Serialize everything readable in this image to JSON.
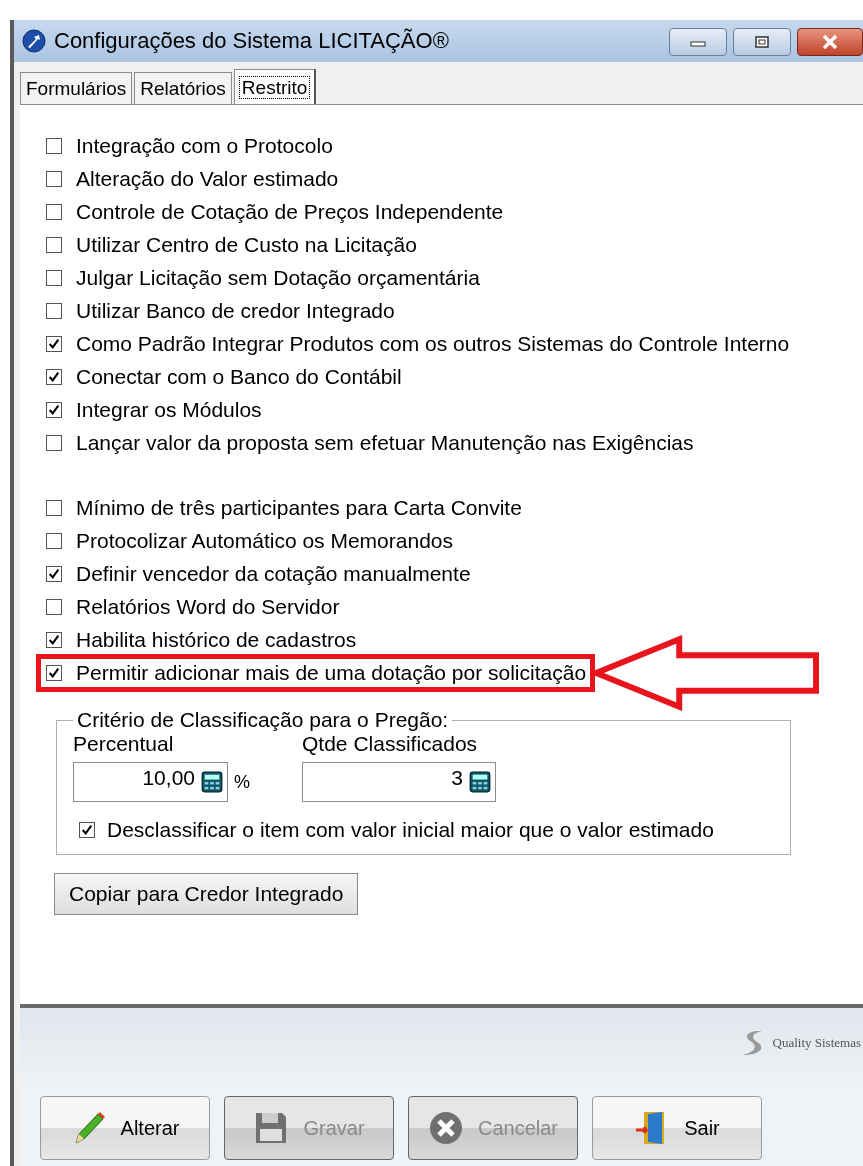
{
  "window": {
    "title": "Configurações do Sistema LICITAÇÃO®"
  },
  "tabs": [
    {
      "label": "Formulários",
      "selected": false
    },
    {
      "label": "Relatórios",
      "selected": false
    },
    {
      "label": "Restrito",
      "selected": true
    }
  ],
  "option_groups": [
    {
      "options": [
        {
          "label": "Integração com o Protocolo",
          "checked": false,
          "highlighted": false
        },
        {
          "label": "Alteração do Valor estimado",
          "checked": false,
          "highlighted": false
        },
        {
          "label": "Controle de Cotação de Preços Independente",
          "checked": false,
          "highlighted": false
        },
        {
          "label": "Utilizar Centro de Custo na Licitação",
          "checked": false,
          "highlighted": false
        },
        {
          "label": "Julgar Licitação sem Dotação orçamentária",
          "checked": false,
          "highlighted": false
        },
        {
          "label": "Utilizar Banco de credor Integrado",
          "checked": false,
          "highlighted": false
        },
        {
          "label": "Como Padrão Integrar Produtos com os outros Sistemas do Controle Interno",
          "checked": true,
          "highlighted": false
        },
        {
          "label": "Conectar com o Banco do Contábil",
          "checked": true,
          "highlighted": false
        },
        {
          "label": "Integrar os Módulos",
          "checked": true,
          "highlighted": false
        },
        {
          "label": "Lançar valor da proposta sem efetuar Manutenção nas Exigências",
          "checked": false,
          "highlighted": false
        }
      ]
    },
    {
      "options": [
        {
          "label": "Mínimo de três participantes para Carta Convite",
          "checked": false,
          "highlighted": false
        },
        {
          "label": "Protocolizar Automático os Memorandos",
          "checked": false,
          "highlighted": false
        },
        {
          "label": "Definir vencedor da cotação manualmente",
          "checked": true,
          "highlighted": false
        },
        {
          "label": "Relatórios Word do Servidor",
          "checked": false,
          "highlighted": false
        },
        {
          "label": "Habilita histórico de cadastros",
          "checked": true,
          "highlighted": false
        },
        {
          "label": "Permitir adicionar mais de uma dotação por solicitação",
          "checked": true,
          "highlighted": true
        }
      ]
    }
  ],
  "classification": {
    "title": "Critério de Classificação para o Pregão:",
    "percent_label": "Percentual",
    "percent_value": "10,00",
    "percent_unit": "%",
    "count_label": "Qtde Classificados",
    "count_value": "3",
    "disqualify": {
      "label": "Desclassificar o item com valor inicial maior que o valor estimado",
      "checked": true
    }
  },
  "copy_button": "Copiar para Credor Integrado",
  "footer": {
    "logo_text": "Quality Sistemas"
  },
  "buttons": [
    {
      "label": "Alterar",
      "kind": "edit",
      "disabled": false
    },
    {
      "label": "Gravar",
      "kind": "save",
      "disabled": true
    },
    {
      "label": "Cancelar",
      "kind": "cancel",
      "disabled": true
    },
    {
      "label": "Sair",
      "kind": "exit",
      "disabled": false
    }
  ]
}
